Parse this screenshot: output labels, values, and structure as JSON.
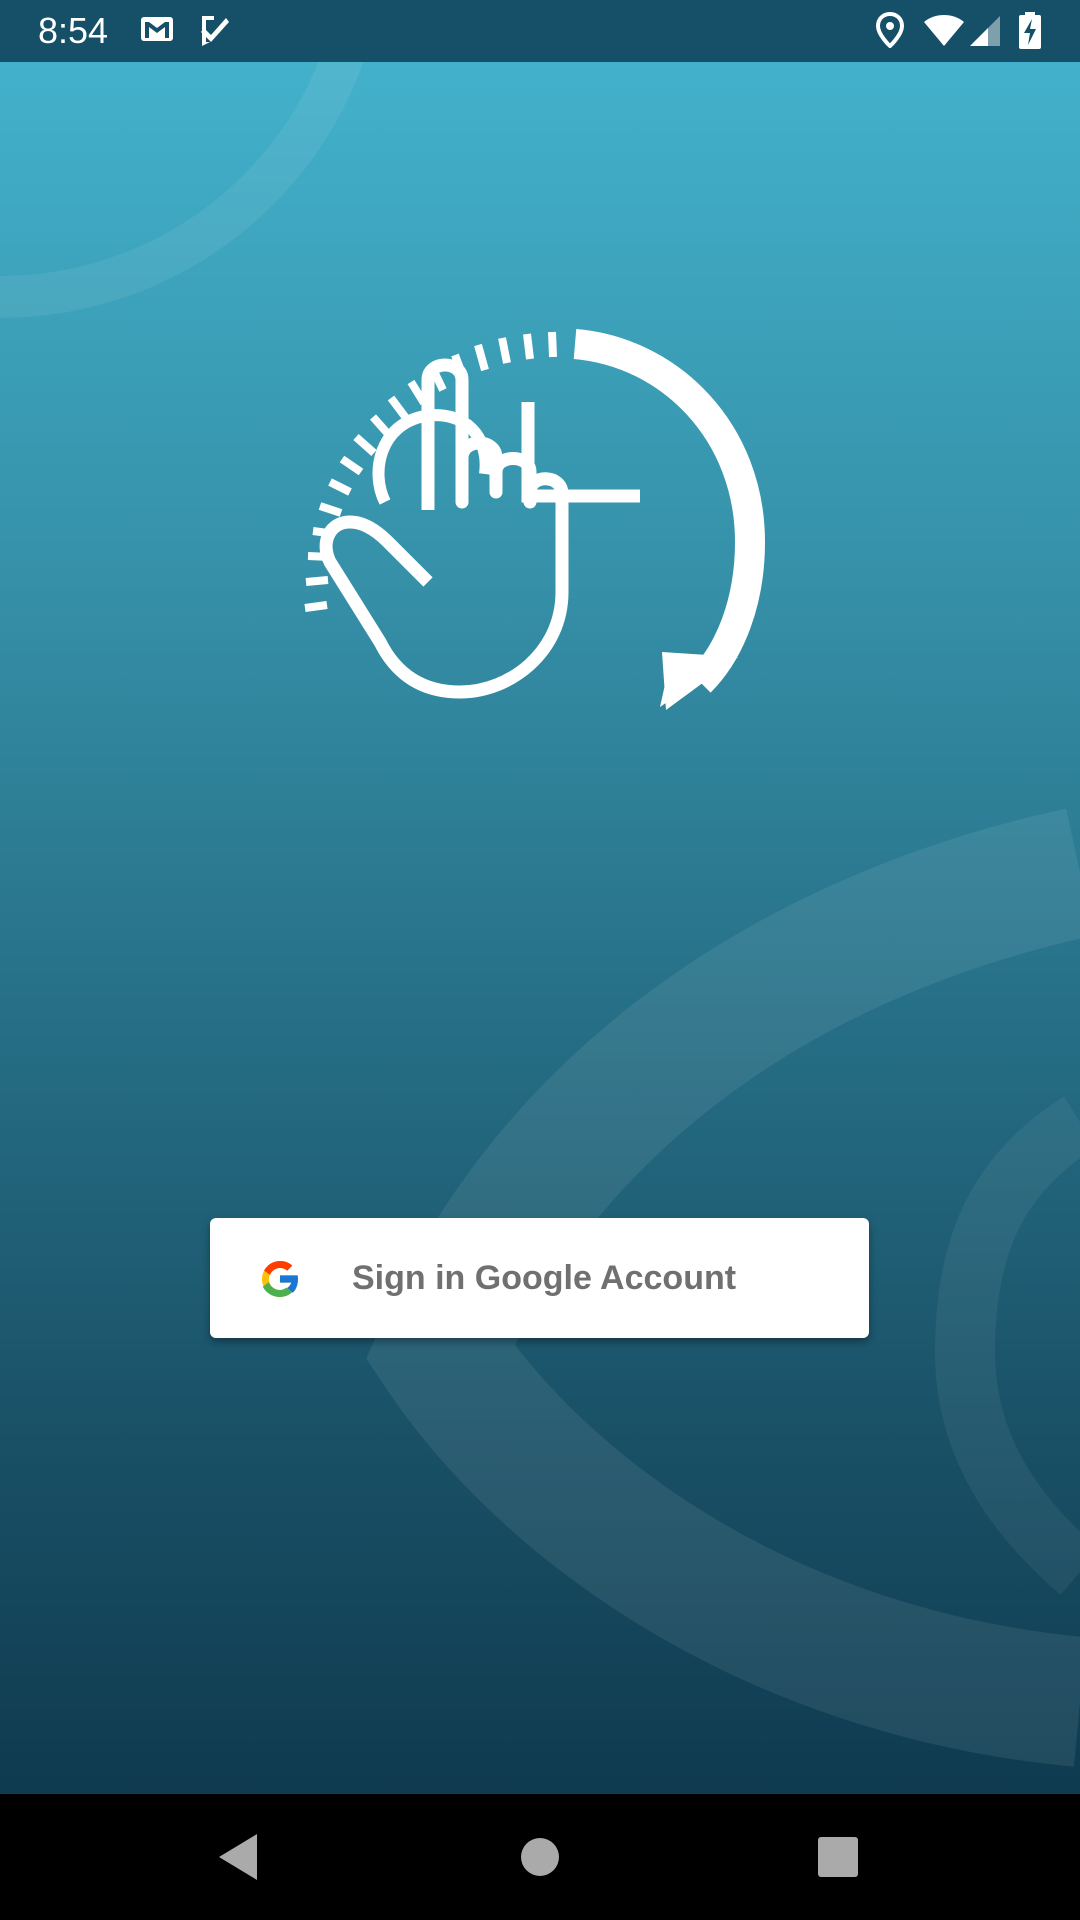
{
  "status_bar": {
    "time": "8:54",
    "left_icons": [
      "gmail-icon",
      "tasks-check-icon"
    ],
    "right_icons": [
      "location-icon",
      "wifi-icon",
      "cell-signal-icon",
      "battery-charging-icon"
    ],
    "background": "#155068"
  },
  "main": {
    "logo_icon": "tap-hand-clock-icon",
    "signin_button": {
      "label": "Sign in Google Account",
      "icon": "google-g-icon"
    },
    "colors": {
      "gradient_top": "#43b1cb",
      "gradient_bottom": "#0f3a4f",
      "button_text": "#707070"
    }
  },
  "nav_bar": {
    "buttons": [
      "back-icon",
      "home-icon",
      "recents-icon"
    ]
  }
}
